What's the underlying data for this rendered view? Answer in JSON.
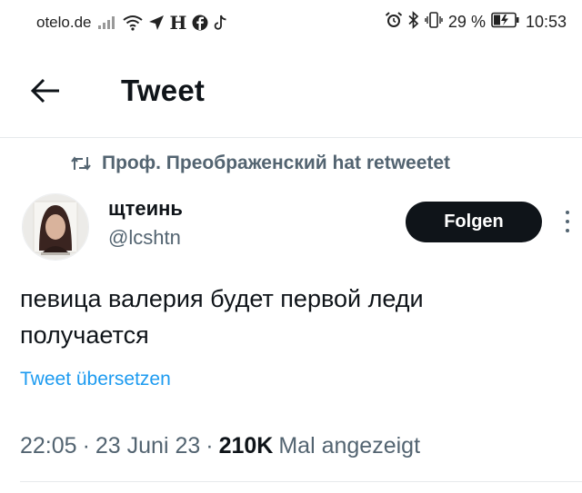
{
  "status_bar": {
    "carrier": "otelo.de",
    "battery": "29 %",
    "time": "10:53",
    "icons": [
      "signal-icon",
      "wifi-icon",
      "navigation-icon",
      "h-icon",
      "facebook-icon",
      "tiktok-icon",
      "alarm-icon",
      "bluetooth-icon",
      "vibrate-icon",
      "battery-icon"
    ]
  },
  "header": {
    "title": "Tweet"
  },
  "retweet": {
    "label": "Проф. Преображенский hat retweetet"
  },
  "author": {
    "name": "щтеинь",
    "handle": "@lcshtn"
  },
  "follow_button": "Folgen",
  "tweet": {
    "text": "певица валерия будет первой леди\nполучается",
    "translate": "Tweet übersetzen"
  },
  "meta": {
    "time": "22:05",
    "date": "23 Juni 23",
    "views": "210K",
    "views_suffix": "Mal angezeigt"
  },
  "colors": {
    "accent": "#1d9bf0",
    "muted": "#536471",
    "text": "#0f1419"
  }
}
